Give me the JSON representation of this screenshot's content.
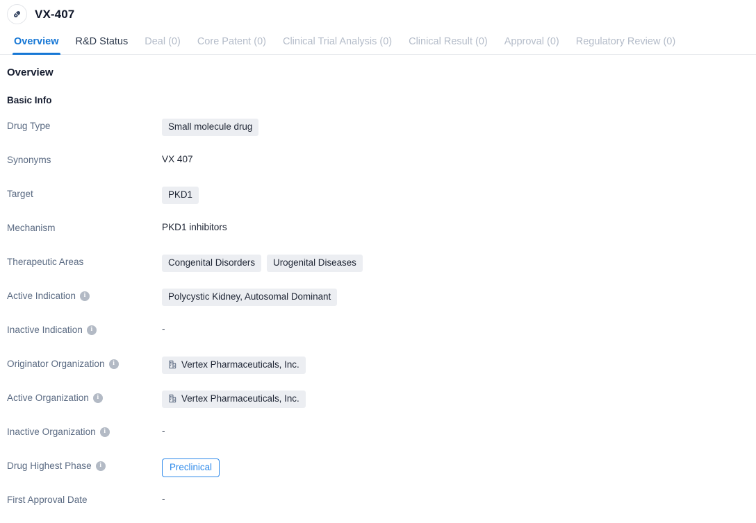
{
  "header": {
    "title": "VX-407",
    "avatar_icon": "pill-capsule-icon"
  },
  "tabs": [
    {
      "label": "Overview",
      "state": "active"
    },
    {
      "label": "R&D Status",
      "state": "enabled"
    },
    {
      "label": "Deal (0)",
      "state": "muted"
    },
    {
      "label": "Core Patent (0)",
      "state": "muted"
    },
    {
      "label": "Clinical Trial Analysis (0)",
      "state": "muted"
    },
    {
      "label": "Clinical Result (0)",
      "state": "muted"
    },
    {
      "label": "Approval (0)",
      "state": "muted"
    },
    {
      "label": "Regulatory Review (0)",
      "state": "muted"
    }
  ],
  "overview": {
    "section_title": "Overview",
    "subsection_title": "Basic Info",
    "rows": [
      {
        "label": "Drug Type",
        "info": false,
        "chips": [
          "Small molecule drug"
        ]
      },
      {
        "label": "Synonyms",
        "info": false,
        "plain": "VX 407"
      },
      {
        "label": "Target",
        "info": false,
        "chips": [
          "PKD1"
        ]
      },
      {
        "label": "Mechanism",
        "info": false,
        "plain": "PKD1 inhibitors"
      },
      {
        "label": "Therapeutic Areas",
        "info": false,
        "chips": [
          "Congenital Disorders",
          "Urogenital Diseases"
        ]
      },
      {
        "label": "Active Indication",
        "info": true,
        "chips": [
          "Polycystic Kidney, Autosomal Dominant"
        ]
      },
      {
        "label": "Inactive Indication",
        "info": true,
        "dash": "-"
      },
      {
        "label": "Originator Organization",
        "info": true,
        "org_chips": [
          "Vertex Pharmaceuticals, Inc."
        ]
      },
      {
        "label": "Active Organization",
        "info": true,
        "org_chips": [
          "Vertex Pharmaceuticals, Inc."
        ]
      },
      {
        "label": "Inactive Organization",
        "info": true,
        "dash": "-"
      },
      {
        "label": "Drug Highest Phase",
        "info": true,
        "badge": "Preclinical"
      },
      {
        "label": "First Approval Date",
        "info": false,
        "dash": "-"
      }
    ]
  },
  "colors": {
    "accent_blue": "#1677d5",
    "badge_blue": "#2b88ea",
    "chip_bg": "#eceef2",
    "label_gray": "#5b6b83",
    "muted_tab": "#b4bcc9"
  },
  "icons": {
    "info": "i",
    "org": "building-icon"
  }
}
